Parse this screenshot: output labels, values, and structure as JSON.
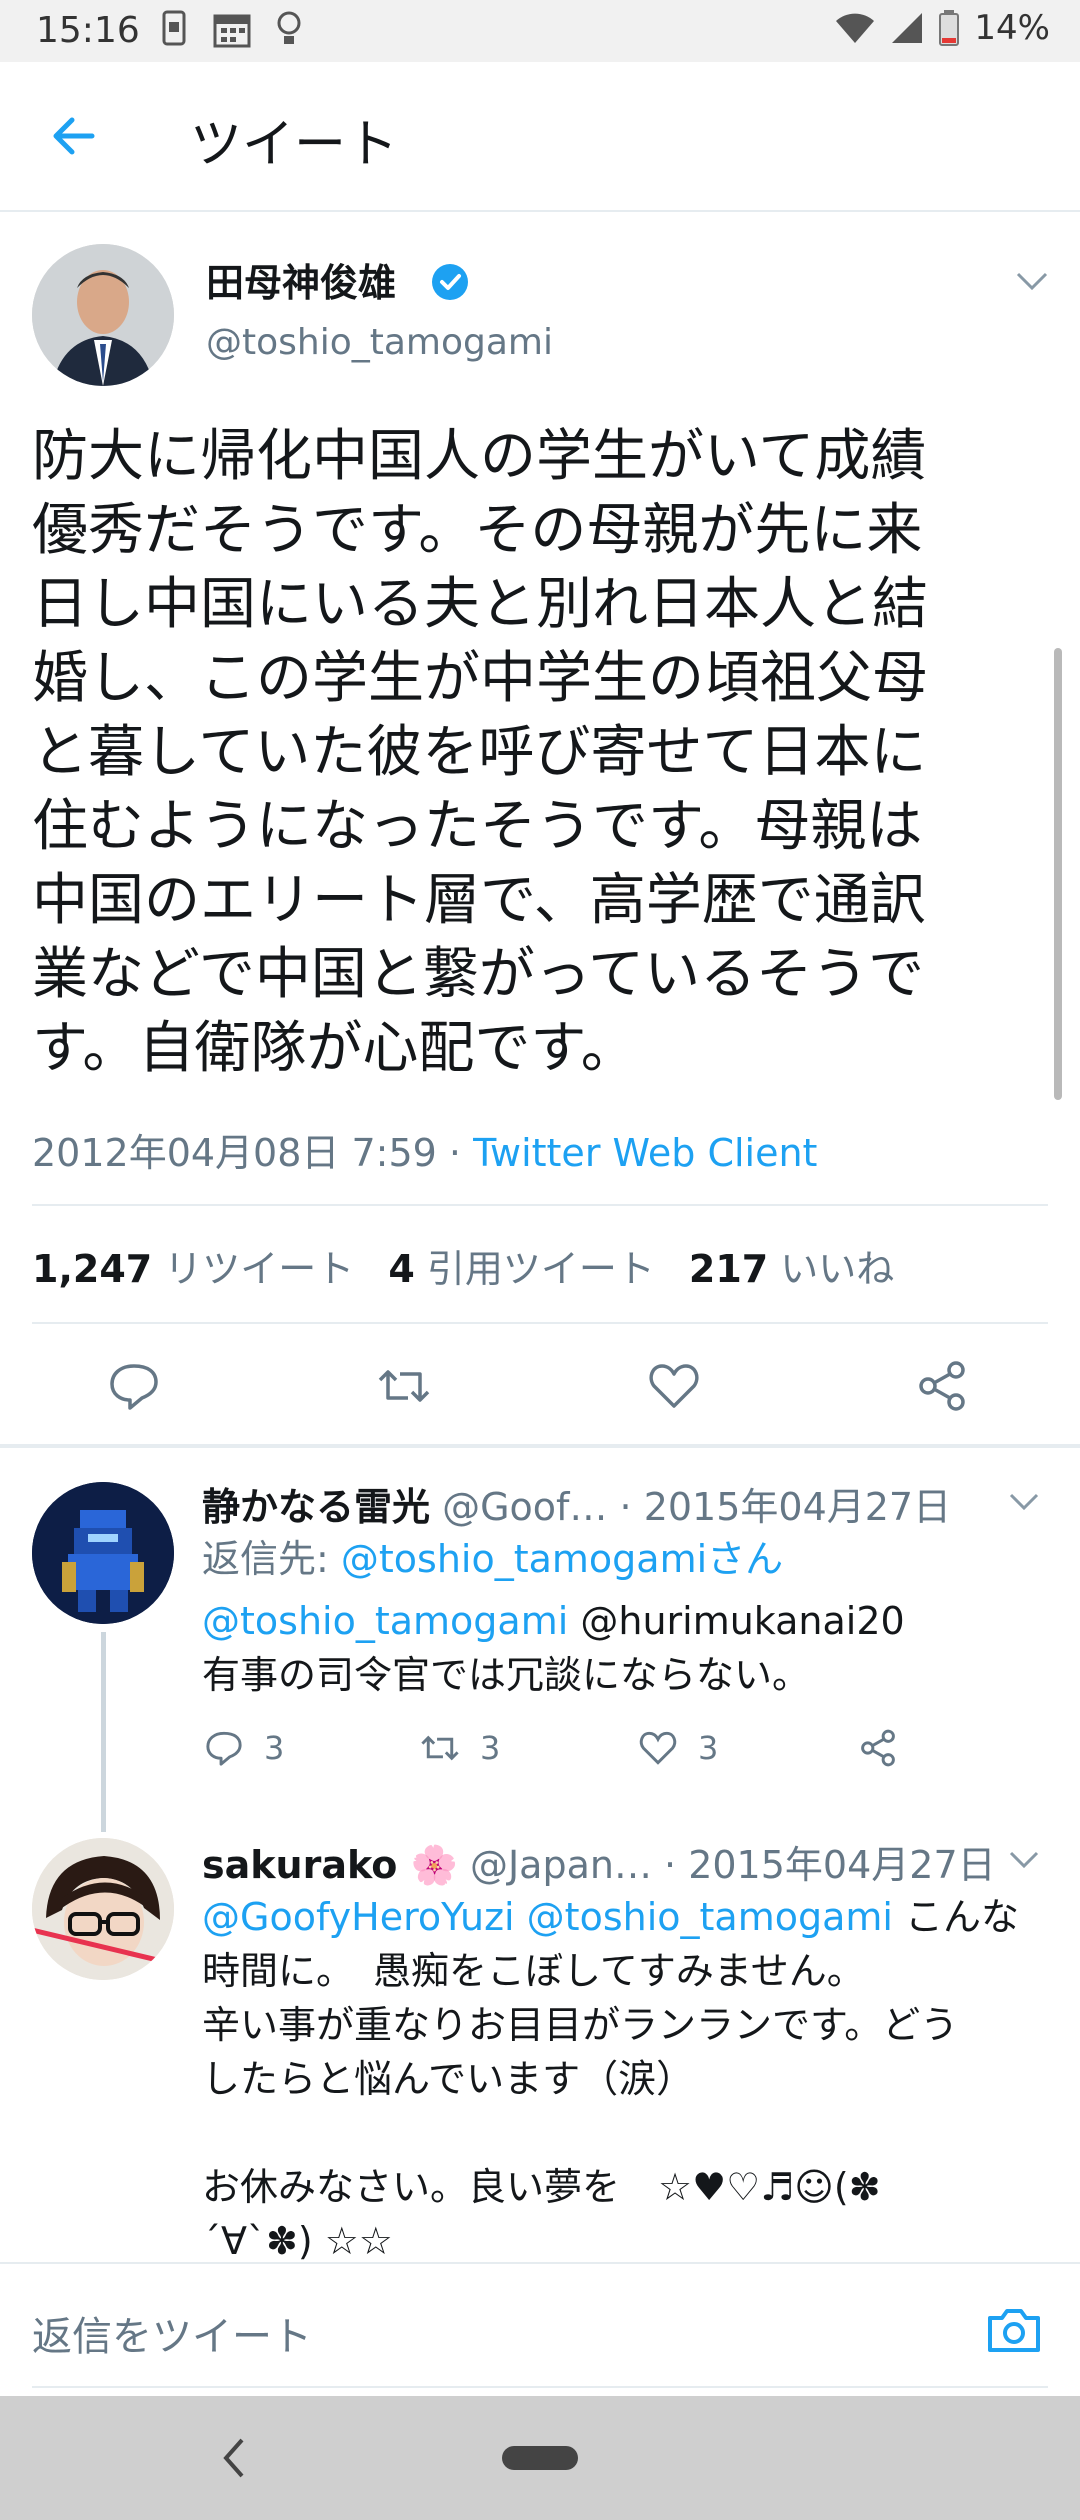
{
  "status_bar": {
    "time": "15:16",
    "battery": "14%"
  },
  "header": {
    "title": "ツイート"
  },
  "tweet": {
    "display_name": "田母神俊雄",
    "handle": "@toshio_tamogami",
    "text": "防大に帰化中国人の学生がいて成績\n優秀だそうです。その母親が先に来\n日し中国にいる夫と別れ日本人と結\n婚し、この学生が中学生の頃祖父母\nと暮していた彼を呼び寄せて日本に\n住むようになったそうです。母親は\n中国のエリート層で、高学歴で通訳\n業などで中国と繋がっているそうで\nす。自衛隊が心配です。",
    "timestamp": "2012年04月08日 7:59",
    "separator": " · ",
    "client": "Twitter Web Client",
    "stats": {
      "retweets_count": "1,247",
      "retweets_label": "リツイート",
      "quotes_count": "4",
      "quotes_label": "引用ツイート",
      "likes_count": "217",
      "likes_label": "いいね"
    }
  },
  "replies": [
    {
      "display_name": "静かなる雷光",
      "handle": "@Goof…",
      "date": "· 2015年04月27日",
      "reply_to_label": "返信先: ",
      "reply_to_handle": "@toshio_tamogamiさん",
      "mention_1": "@toshio_tamogami",
      "mention_2": " @hurimukanai20",
      "body": "有事の司令官では冗談にならない。",
      "reply_count": "3",
      "retweet_count": "3",
      "like_count": "3"
    },
    {
      "display_name": "sakurako 🌸",
      "handle": "@Japan…",
      "date": "· 2015年04月27日",
      "mention_1": "@GoofyHeroYuzi",
      "mention_2": "@toshio_tamogami",
      "body_inline": " こんな",
      "body": "時間に。　愚痴をこぼしてすみません。\n辛い事が重なりお目目がランランです。どう\nしたらと悩んでいます（涙）\n\nお休みなさい。良い夢を　☆♥♡♬☺(✽\n´∀`✽) ☆☆"
    }
  ],
  "compose": {
    "placeholder": "返信をツイート"
  },
  "colors": {
    "accent": "#1da1f2",
    "secondary_text": "#657786",
    "divider": "#e6ecf0"
  },
  "icons": [
    "back-arrow-icon",
    "verified-badge-icon",
    "reply-icon",
    "retweet-icon",
    "like-icon",
    "share-icon",
    "camera-icon",
    "caret-down-icon"
  ]
}
